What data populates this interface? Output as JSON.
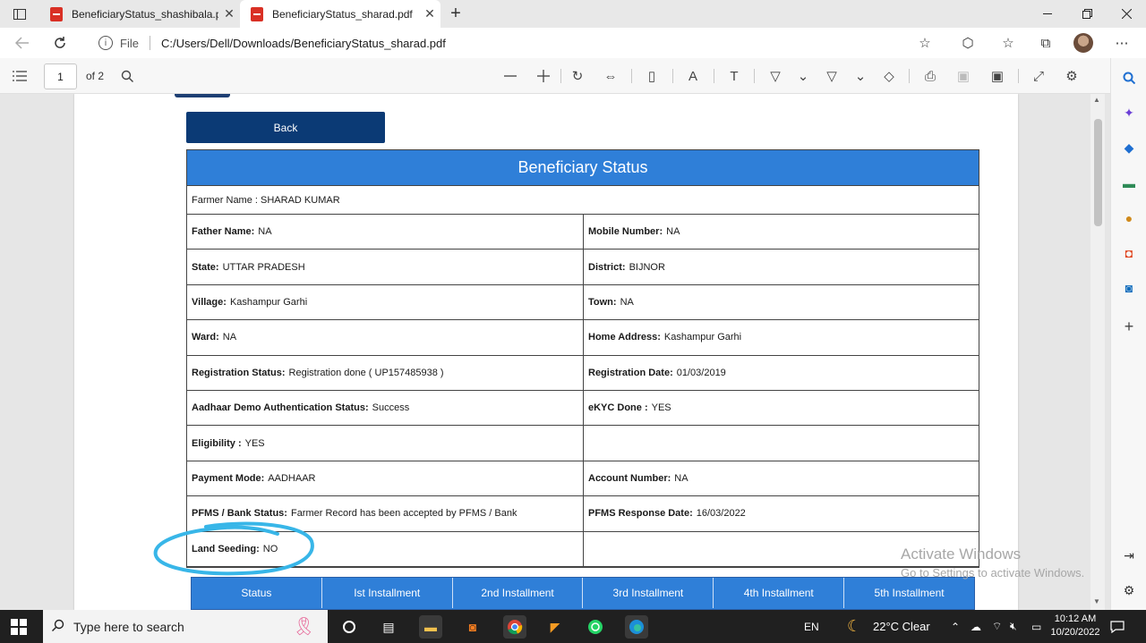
{
  "browser": {
    "tabs": [
      {
        "title": "BeneficiaryStatus_shashibala.pdf",
        "active": false
      },
      {
        "title": "BeneficiaryStatus_sharad.pdf",
        "active": true
      }
    ],
    "close_glyph": "✕",
    "new_tab_glyph": "+",
    "address": {
      "scheme_label": "File",
      "url": "C:/Users/Dell/Downloads/BeneficiaryStatus_sharad.pdf"
    }
  },
  "pdf_toolbar": {
    "page_current": "1",
    "page_of": "of 2"
  },
  "document": {
    "back_label": "Back",
    "header_title": "Beneficiary Status",
    "farmer_name": "Farmer Name : SHARAD KUMAR",
    "rows": [
      [
        {
          "label": "Father Name:",
          "value": "NA"
        },
        {
          "label": "Mobile Number:",
          "value": "NA"
        }
      ],
      [
        {
          "label": "State:",
          "value": "UTTAR PRADESH"
        },
        {
          "label": "District:",
          "value": "BIJNOR"
        }
      ],
      [
        {
          "label": "Village:",
          "value": "Kashampur Garhi"
        },
        {
          "label": "Town:",
          "value": "NA"
        }
      ],
      [
        {
          "label": "Ward:",
          "value": "NA"
        },
        {
          "label": "Home Address:",
          "value": "Kashampur Garhi"
        }
      ],
      [
        {
          "label": "Registration Status:",
          "value": "Registration done ( UP157485938 )"
        },
        {
          "label": "Registration Date:",
          "value": "01/03/2019"
        }
      ],
      [
        {
          "label": "Aadhaar Demo Authentication Status:",
          "value": "Success"
        },
        {
          "label": "eKYC Done :",
          "value": "YES"
        }
      ],
      [
        {
          "label": "Eligibility :",
          "value": "YES"
        },
        {
          "label": "",
          "value": ""
        }
      ],
      [
        {
          "label": "Payment Mode:",
          "value": "AADHAAR"
        },
        {
          "label": "Account Number:",
          "value": "NA"
        }
      ],
      [
        {
          "label": "PFMS / Bank Status:",
          "value": "Farmer Record has been accepted by PFMS / Bank"
        },
        {
          "label": "PFMS Response Date:",
          "value": "16/03/2022"
        }
      ],
      [
        {
          "label": "Land Seeding:",
          "value": "NO"
        },
        {
          "label": "",
          "value": ""
        }
      ]
    ],
    "installment_headers": [
      "Status",
      "Ist Installment",
      "2nd Installment",
      "3rd Installment",
      "4th Installment",
      "5th Installment"
    ]
  },
  "watermark": {
    "line1": "Activate Windows",
    "line2": "Go to Settings to activate Windows."
  },
  "taskbar": {
    "search_placeholder": "Type here to search",
    "language": "EN",
    "weather": "22°C  Clear",
    "time": "10:12 AM",
    "date": "10/20/2022"
  },
  "colors": {
    "header_blue": "#2f7fd8",
    "button_navy": "#0b3a75",
    "annotation_circle": "#38b6e8"
  }
}
